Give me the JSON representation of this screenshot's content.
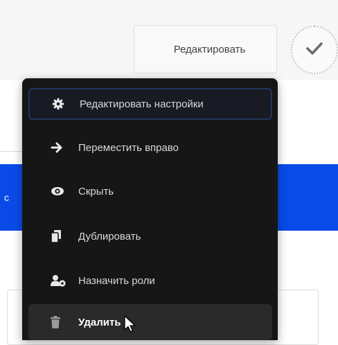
{
  "toolbar": {
    "edit_label": "Редактировать"
  },
  "banner": {
    "text": "с"
  },
  "menu": {
    "items": [
      {
        "label": "Редактировать настройки",
        "icon": "gear-icon"
      },
      {
        "label": "Переместить вправо",
        "icon": "arrow-right-icon"
      },
      {
        "label": "Скрыть",
        "icon": "eye-icon"
      },
      {
        "label": "Дублировать",
        "icon": "copy-icon"
      },
      {
        "label": "Назначить роли",
        "icon": "user-gear-icon"
      },
      {
        "label": "Удалить",
        "icon": "trash-icon"
      }
    ]
  },
  "colors": {
    "accent": "#0a4be8",
    "menu_bg": "#161616",
    "focus_border": "#20355e"
  }
}
